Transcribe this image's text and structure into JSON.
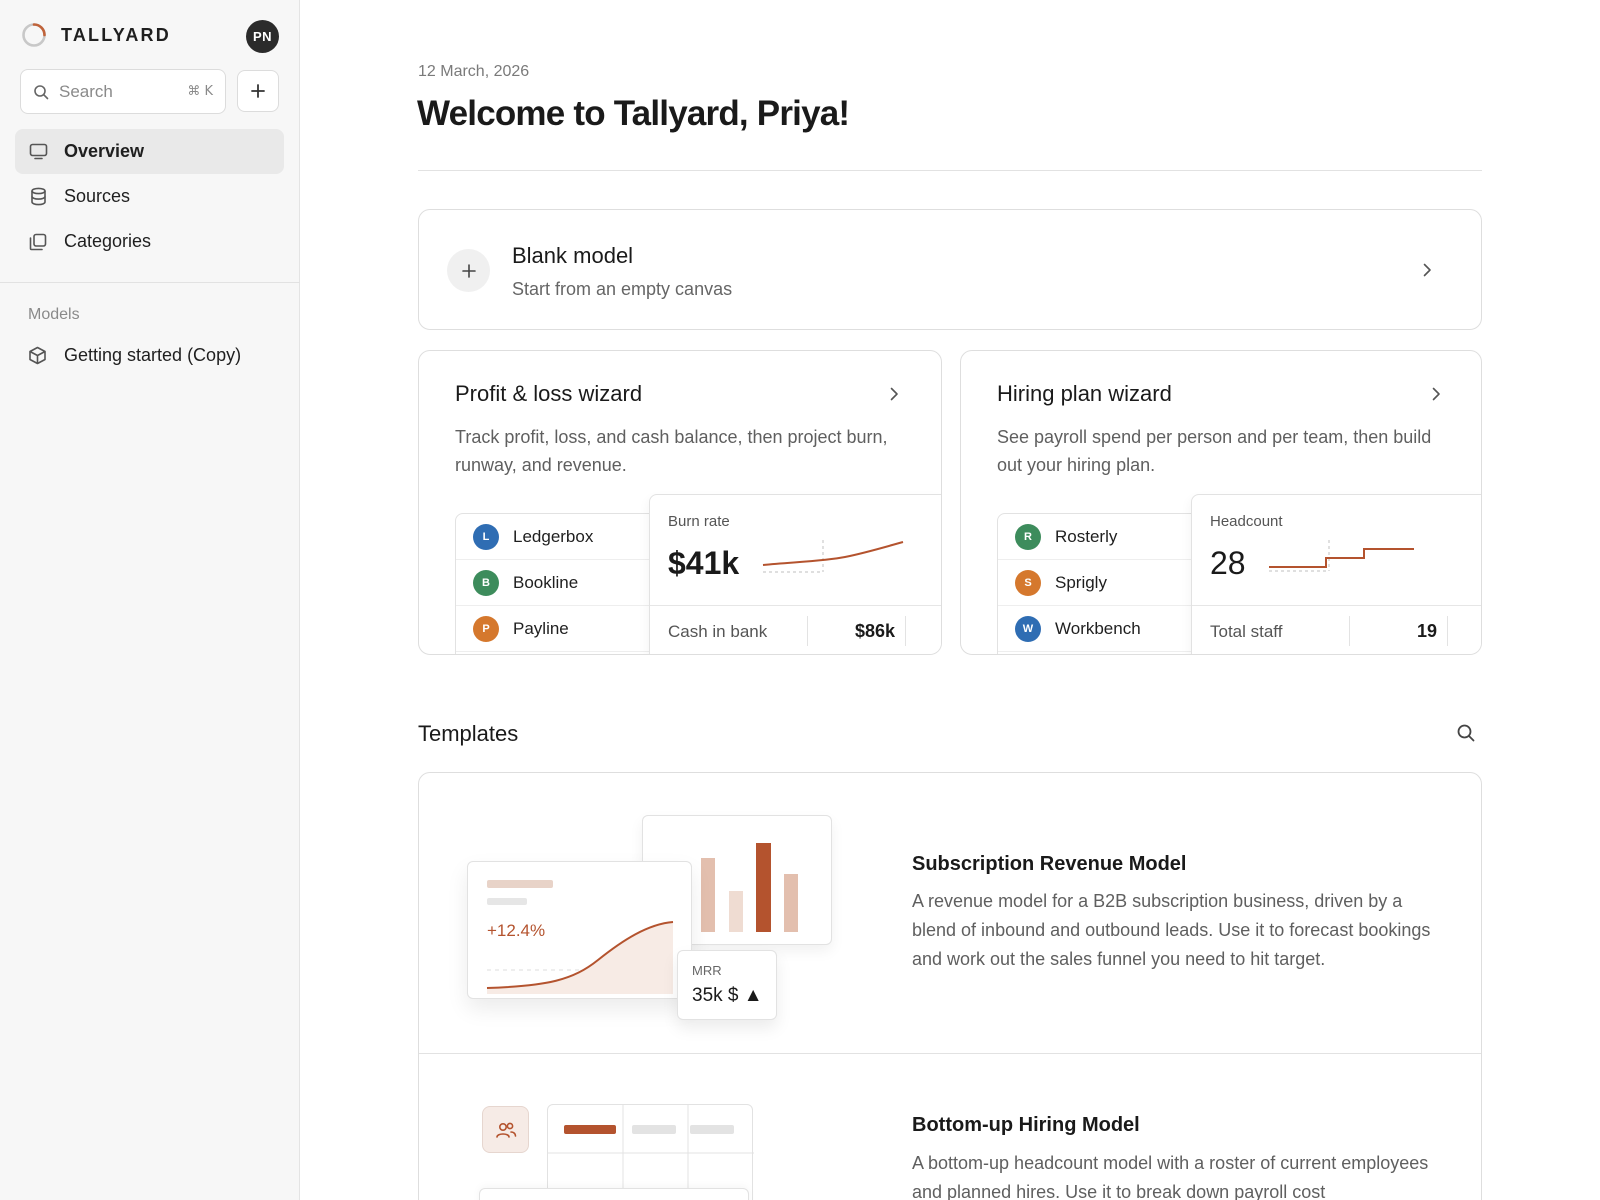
{
  "sidebar": {
    "brand": "TALLYARD",
    "avatar_initials": "PN",
    "search": {
      "placeholder": "Search",
      "shortcut": "⌘ K"
    },
    "nav": [
      {
        "label": "Overview",
        "icon": "monitor-icon",
        "active": true
      },
      {
        "label": "Sources",
        "icon": "database-icon",
        "active": false
      },
      {
        "label": "Categories",
        "icon": "copy-icon",
        "active": false
      }
    ],
    "models_label": "Models",
    "models": [
      {
        "label": "Getting started (Copy)",
        "icon": "cube-icon"
      }
    ]
  },
  "main": {
    "date": "12 March, 2026",
    "title": "Welcome to Tallyard, Priya!",
    "blank_model": {
      "title": "Blank model",
      "subtitle": "Start from an empty canvas"
    },
    "wizards": {
      "pl": {
        "title": "Profit & loss wizard",
        "description": "Track profit, loss, and cash balance, then project burn, runway, and revenue.",
        "sources": [
          {
            "initial": "L",
            "name": "Ledgerbox",
            "color": "#2f6db3"
          },
          {
            "initial": "B",
            "name": "Bookline",
            "color": "#3d8c5c"
          },
          {
            "initial": "P",
            "name": "Payline",
            "color": "#d5782d"
          }
        ],
        "stat": {
          "label": "Burn rate",
          "value": "$41k",
          "footer_label": "Cash in bank",
          "footer_value": "$86k"
        }
      },
      "hp": {
        "title": "Hiring plan wizard",
        "description": "See payroll spend per person and per team, then build out your hiring plan.",
        "sources": [
          {
            "initial": "R",
            "name": "Rosterly",
            "color": "#3d8c5c"
          },
          {
            "initial": "S",
            "name": "Sprigly",
            "color": "#d5782d"
          },
          {
            "initial": "W",
            "name": "Workbench",
            "color": "#2f6db3"
          }
        ],
        "stat": {
          "label": "Headcount",
          "value": "28",
          "footer_label": "Total staff",
          "footer_value": "19"
        }
      }
    },
    "templates": {
      "heading": "Templates",
      "items": [
        {
          "title": "Subscription Revenue Model",
          "description": "A revenue model for a B2B subscription business, driven by a blend of inbound and outbound leads. Use it to forecast bookings and work out the sales funnel you need to hit target.",
          "illustration": {
            "growth": "+12.4%",
            "metric_label": "MRR",
            "metric_value": "35k $ ▲"
          }
        },
        {
          "title": "Bottom-up Hiring Model",
          "description": "A bottom-up headcount model with a roster of current employees and planned hires. Use it to break down payroll cost"
        }
      ]
    }
  },
  "colors": {
    "accent": "#b4532e",
    "accent_light": "#e3bfae"
  }
}
